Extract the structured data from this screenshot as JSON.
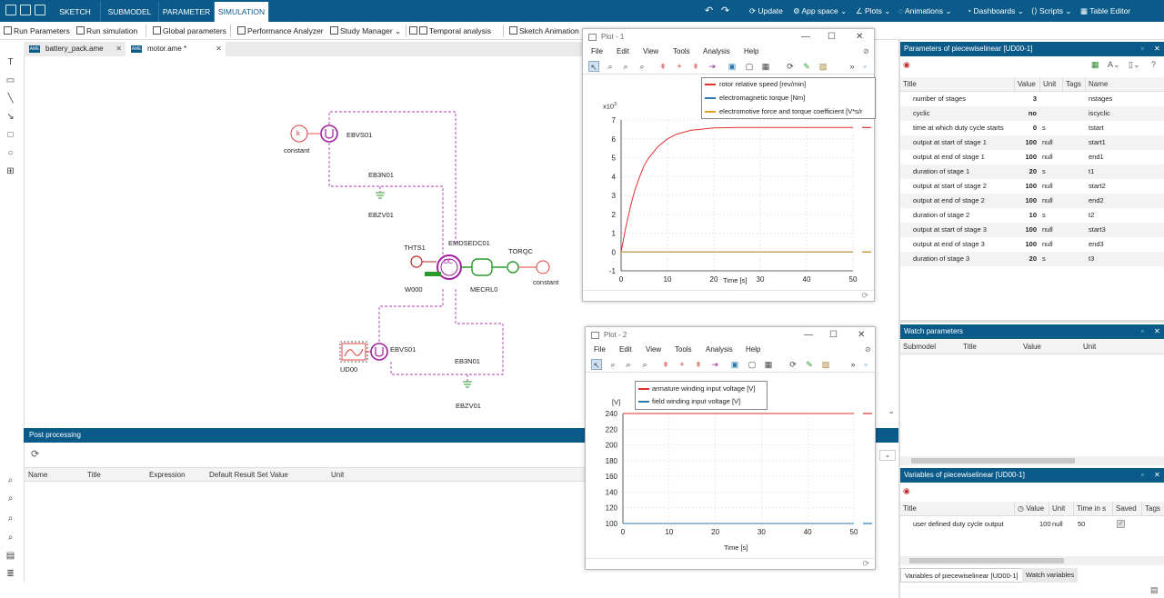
{
  "titlebar": {
    "mode_tabs": [
      "SKETCH",
      "SUBMODEL",
      "PARAMETER",
      "SIMULATION"
    ],
    "active_tab": "SIMULATION",
    "right_items": [
      "Update",
      "App space",
      "Plots",
      "Animations",
      "Dashboards",
      "Scripts",
      "Table Editor"
    ]
  },
  "toolbar": {
    "run_parameters": "Run Parameters",
    "run_simulation": "Run simulation",
    "global_parameters": "Global parameters",
    "performance_analyzer": "Performance Analyzer",
    "study_manager": "Study Manager",
    "temporal_analysis": "Temporal analysis",
    "sketch_animation": "Sketch Animation"
  },
  "doc_tabs": [
    {
      "label": "battery_pack.ame",
      "icon": "AME"
    },
    {
      "label": "motor.ame *",
      "icon": "AME"
    }
  ],
  "sketch": {
    "components": {
      "k": "k",
      "constant_top": "constant",
      "ebvs01_top": "EBVS01",
      "eb3n01_top": "EB3N01",
      "ebzv01_top": "EBZV01",
      "thts1": "THTS1",
      "emdsedc01": "EMDSEDC01",
      "dc": "DC",
      "torqc": "TORQC",
      "constant_right": "constant",
      "w000": "W000",
      "mecrl0": "MECRL0",
      "ud00": "UD00",
      "ebvs01_bottom": "EBVS01",
      "eb3n01_bottom": "EB3N01",
      "ebzv01_bottom": "EBZV01"
    }
  },
  "post_processing": {
    "title": "Post processing",
    "columns": [
      "Name",
      "Title",
      "Expression",
      "Default Result Set",
      "Value",
      "Unit"
    ]
  },
  "plot1": {
    "window_title": "Plot - 1",
    "menu": [
      "File",
      "Edit",
      "View",
      "Tools",
      "Analysis",
      "Help"
    ],
    "legend": [
      {
        "label": "rotor relative speed [rev/min]",
        "color": "#e03030"
      },
      {
        "label": "electromagnetic torque [Nm]",
        "color": "#2a7ab0"
      },
      {
        "label": "electromotive force and torque coefficient [V*s/r",
        "color": "#e0a020"
      }
    ],
    "y_multiplier": "x10",
    "y_multiplier_exp": "3",
    "xlabel": "Time [s]"
  },
  "plot2": {
    "window_title": "Plot - 2",
    "menu": [
      "File",
      "Edit",
      "View",
      "Tools",
      "Analysis",
      "Help"
    ],
    "legend": [
      {
        "label": "armature winding input voltage [V]",
        "color": "#e03030"
      },
      {
        "label": "field winding input voltage [V]",
        "color": "#2a7ab0"
      }
    ],
    "ylabel": "[V]",
    "xlabel": "Time [s]"
  },
  "chart_data": [
    {
      "type": "line",
      "xlabel": "Time [s]",
      "ylabel": "",
      "xlim": [
        0,
        50
      ],
      "ylim": [
        -1,
        7
      ],
      "xticks": [
        "0",
        "10",
        "20",
        "30",
        "40",
        "50"
      ],
      "yticks": [
        "-1",
        "0",
        "1",
        "2",
        "3",
        "4",
        "5",
        "6",
        "7"
      ],
      "grid": true,
      "legend_position": "top",
      "series": [
        {
          "name": "rotor relative speed [rev/min]",
          "x": [
            0,
            1,
            2,
            3,
            4,
            5,
            6,
            8,
            10,
            12,
            15,
            20,
            25,
            30,
            40,
            50
          ],
          "y": [
            0,
            1.3,
            2.4,
            3.3,
            4.0,
            4.6,
            5.0,
            5.6,
            6.0,
            6.25,
            6.45,
            6.58,
            6.6,
            6.6,
            6.6,
            6.6
          ]
        },
        {
          "name": "electromagnetic torque [Nm]",
          "x": [
            0,
            50
          ],
          "y": [
            0,
            0
          ]
        },
        {
          "name": "electromotive force and torque coefficient [V*s/r",
          "x": [
            0,
            50
          ],
          "y": [
            0,
            0
          ]
        }
      ]
    },
    {
      "type": "line",
      "xlabel": "Time [s]",
      "ylabel": "[V]",
      "xlim": [
        0,
        50
      ],
      "ylim": [
        100,
        240
      ],
      "xticks": [
        "0",
        "10",
        "20",
        "30",
        "40",
        "50"
      ],
      "yticks": [
        "100",
        "120",
        "140",
        "160",
        "180",
        "200",
        "220",
        "240"
      ],
      "grid": true,
      "legend_position": "top",
      "series": [
        {
          "name": "armature winding input voltage [V]",
          "x": [
            0,
            50
          ],
          "y": [
            240,
            240
          ]
        },
        {
          "name": "field winding input voltage [V]",
          "x": [
            0,
            50
          ],
          "y": [
            100,
            100
          ]
        }
      ]
    }
  ],
  "params_panel": {
    "title": "Parameters of piecewiselinear [UD00-1]",
    "columns": [
      "Title",
      "Value",
      "Unit",
      "Tags",
      "Name"
    ],
    "rows": [
      {
        "title": "number of stages",
        "value": "3",
        "unit": "",
        "name": "nstages"
      },
      {
        "title": "cyclic",
        "value": "no",
        "unit": "",
        "name": "iscyclic"
      },
      {
        "title": "time at which duty cycle starts",
        "value": "0",
        "unit": "s",
        "name": "tstart"
      },
      {
        "title": "output at start of stage 1",
        "value": "100",
        "unit": "null",
        "name": "start1"
      },
      {
        "title": "output at end of stage 1",
        "value": "100",
        "unit": "null",
        "name": "end1"
      },
      {
        "title": "duration of stage 1",
        "value": "20",
        "unit": "s",
        "name": "t1"
      },
      {
        "title": "output at start of stage 2",
        "value": "100",
        "unit": "null",
        "name": "start2"
      },
      {
        "title": "output at end of stage 2",
        "value": "100",
        "unit": "null",
        "name": "end2"
      },
      {
        "title": "duration of stage 2",
        "value": "10",
        "unit": "s",
        "name": "t2"
      },
      {
        "title": "output at start of stage 3",
        "value": "100",
        "unit": "null",
        "name": "start3"
      },
      {
        "title": "output at end of stage 3",
        "value": "100",
        "unit": "null",
        "name": "end3"
      },
      {
        "title": "duration of stage 3",
        "value": "20",
        "unit": "s",
        "name": "t3"
      }
    ]
  },
  "watch_panel": {
    "title": "Watch parameters",
    "columns": [
      "Submodel",
      "Title",
      "Value",
      "Unit"
    ]
  },
  "vars_panel": {
    "title": "Variables of piecewiselinear [UD00-1]",
    "columns": [
      "Title",
      "Value",
      "Unit",
      "Time in s",
      "Saved",
      "Tags"
    ],
    "rows": [
      {
        "title": "user defined duty cycle output",
        "value": "100",
        "unit": "null",
        "time": "50"
      }
    ]
  },
  "bottom_tabs": [
    "Variables of piecewiselinear [UD00-1]",
    "Watch variables"
  ]
}
